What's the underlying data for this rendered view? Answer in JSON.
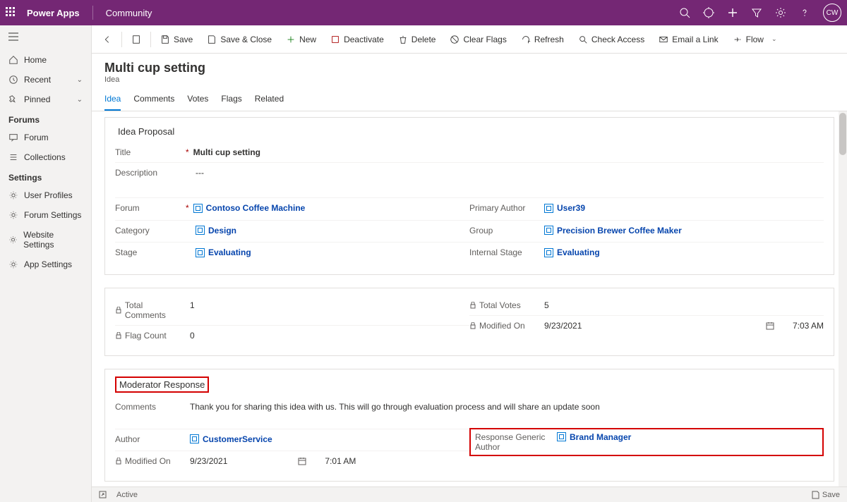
{
  "header": {
    "app": "Power Apps",
    "area": "Community",
    "avatar": "CW"
  },
  "sidebar": {
    "home": "Home",
    "recent": "Recent",
    "pinned": "Pinned",
    "grpForums": "Forums",
    "forum": "Forum",
    "collections": "Collections",
    "grpSettings": "Settings",
    "userProfiles": "User Profiles",
    "forumSettings": "Forum Settings",
    "websiteSettings": "Website Settings",
    "appSettings": "App Settings"
  },
  "commands": {
    "save": "Save",
    "saveClose": "Save & Close",
    "new": "New",
    "deactivate": "Deactivate",
    "delete": "Delete",
    "clearFlags": "Clear Flags",
    "refresh": "Refresh",
    "checkAccess": "Check Access",
    "emailLink": "Email a Link",
    "flow": "Flow"
  },
  "record": {
    "title": "Multi cup setting",
    "entity": "Idea"
  },
  "tabs": {
    "idea": "Idea",
    "comments": "Comments",
    "votes": "Votes",
    "flags": "Flags",
    "related": "Related"
  },
  "proposal": {
    "heading": "Idea Proposal",
    "titleLabel": "Title",
    "titleVal": "Multi cup setting",
    "descLabel": "Description",
    "descVal": "---",
    "forumLabel": "Forum",
    "forumVal": "Contoso Coffee Machine",
    "categoryLabel": "Category",
    "categoryVal": "Design",
    "stageLabel": "Stage",
    "stageVal": "Evaluating",
    "primaryAuthorLabel": "Primary Author",
    "primaryAuthorVal": "User39",
    "groupLabel": "Group",
    "groupVal": "Precision Brewer Coffee Maker",
    "internalStageLabel": "Internal Stage",
    "internalStageVal": "Evaluating"
  },
  "stats": {
    "totalCommentsLabel": "Total Comments",
    "totalCommentsVal": "1",
    "flagCountLabel": "Flag Count",
    "flagCountVal": "0",
    "totalVotesLabel": "Total Votes",
    "totalVotesVal": "5",
    "modifiedOnLabel": "Modified On",
    "modifiedDate": "9/23/2021",
    "modifiedTime": "7:03 AM"
  },
  "moderator": {
    "heading": "Moderator Response",
    "commentsLabel": "Comments",
    "commentsVal": "Thank you for sharing this idea with us. This will go through evaluation process and will share an update soon",
    "authorLabel": "Author",
    "authorVal": "CustomerService",
    "respGenericLabel": "Response Generic Author",
    "respGenericVal": "Brand Manager",
    "modifiedOnLabel": "Modified On",
    "modifiedDate": "9/23/2021",
    "modifiedTime": "7:01 AM"
  },
  "status": {
    "active": "Active",
    "save": "Save"
  }
}
